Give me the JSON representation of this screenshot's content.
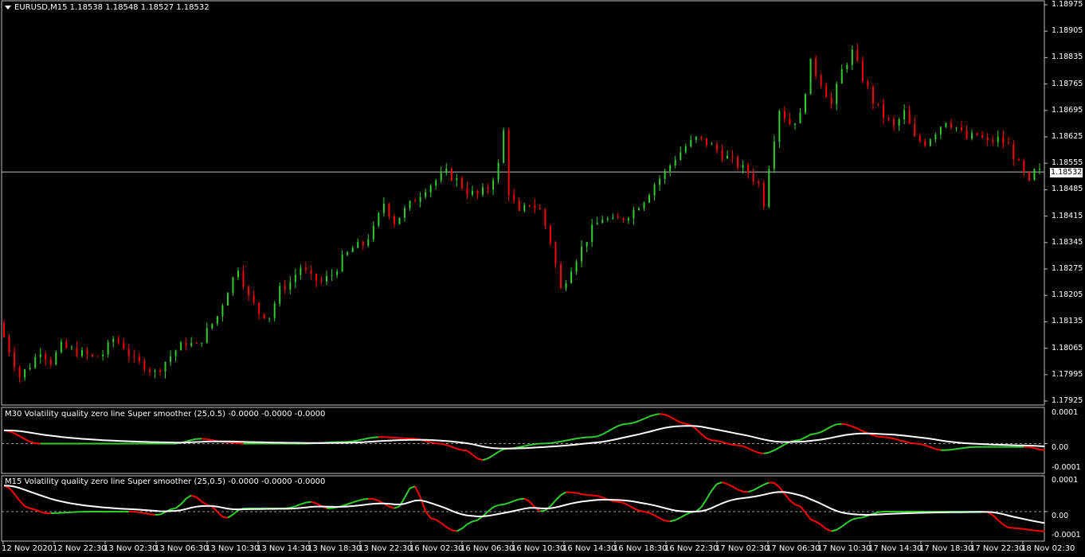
{
  "colors": {
    "background": "#000000",
    "bull": "#32CD32",
    "bear": "#FF0000",
    "signal": "#FFFFFF",
    "grid": "#C0C0C0",
    "price_line": "#C0C0C0"
  },
  "main": {
    "symbol_title": "EURUSD,M15  1.18538 1.18548 1.18527 1.18532",
    "current_price": "1.18532",
    "price_axis": [
      "1.18975",
      "1.18905",
      "1.18835",
      "1.18765",
      "1.18695",
      "1.18625",
      "1.18555",
      "1.18485",
      "1.18415",
      "1.18345",
      "1.18275",
      "1.18205",
      "1.18135",
      "1.18065",
      "1.17995",
      "1.17925"
    ]
  },
  "indicator1": {
    "title": "M30 Volatility quality zero line Super smoother (25,0.5) -0.0000 -0.0000 -0.0000",
    "axis": [
      "0.0001",
      "0.00",
      "-0.0001"
    ]
  },
  "indicator2": {
    "title": "M15 Volatility quality zero line Super smoother (25,0.5) -0.0000 -0.0000 -0.0000",
    "axis": [
      "0.0001",
      "0.00",
      "-0.0001"
    ]
  },
  "time_axis": [
    "12 Nov 2020",
    "12 Nov 22:30",
    "13 Nov 02:30",
    "13 Nov 06:30",
    "13 Nov 10:30",
    "13 Nov 14:30",
    "13 Nov 18:30",
    "13 Nov 22:30",
    "16 Nov 02:30",
    "16 Nov 06:30",
    "16 Nov 10:30",
    "16 Nov 14:30",
    "16 Nov 18:30",
    "16 Nov 22:30",
    "17 Nov 02:30",
    "17 Nov 06:30",
    "17 Nov 10:30",
    "17 Nov 14:30",
    "17 Nov 18:30",
    "17 Nov 22:30",
    "18 Nov 02:30"
  ],
  "chart_data": {
    "type": "candlestick",
    "symbol": "EURUSD",
    "timeframe": "M15",
    "ohlc_last": {
      "open": 1.18538,
      "high": 1.18548,
      "low": 1.18527,
      "close": 1.18532
    },
    "ylim": [
      1.17925,
      1.18975
    ],
    "price_path": [
      [
        0,
        1.1813
      ],
      [
        2,
        1.1806
      ],
      [
        4,
        1.1799
      ],
      [
        6,
        1.1802
      ],
      [
        8,
        1.1806
      ],
      [
        10,
        1.1803
      ],
      [
        12,
        1.1807
      ],
      [
        14,
        1.1806
      ],
      [
        16,
        1.1805
      ],
      [
        18,
        1.1804
      ],
      [
        20,
        1.1805
      ],
      [
        22,
        1.1809
      ],
      [
        24,
        1.1807
      ],
      [
        26,
        1.1803
      ],
      [
        28,
        1.1802
      ],
      [
        30,
        1.18
      ],
      [
        32,
        1.1803
      ],
      [
        34,
        1.1806
      ],
      [
        36,
        1.1808
      ],
      [
        38,
        1.1807
      ],
      [
        40,
        1.1811
      ],
      [
        42,
        1.1815
      ],
      [
        44,
        1.1822
      ],
      [
        46,
        1.1828
      ],
      [
        48,
        1.182
      ],
      [
        50,
        1.1816
      ],
      [
        52,
        1.1815
      ],
      [
        54,
        1.1822
      ],
      [
        56,
        1.1824
      ],
      [
        58,
        1.1828
      ],
      [
        60,
        1.1825
      ],
      [
        62,
        1.1824
      ],
      [
        64,
        1.1826
      ],
      [
        66,
        1.183
      ],
      [
        68,
        1.1833
      ],
      [
        70,
        1.1834
      ],
      [
        72,
        1.1838
      ],
      [
        74,
        1.1845
      ],
      [
        76,
        1.184
      ],
      [
        78,
        1.1843
      ],
      [
        80,
        1.1846
      ],
      [
        82,
        1.1849
      ],
      [
        84,
        1.1851
      ],
      [
        86,
        1.1853
      ],
      [
        88,
        1.1851
      ],
      [
        90,
        1.1848
      ],
      [
        92,
        1.1847
      ],
      [
        94,
        1.1849
      ],
      [
        96,
        1.1855
      ],
      [
        97,
        1.1864
      ],
      [
        98,
        1.1848
      ],
      [
        100,
        1.1842
      ],
      [
        102,
        1.1845
      ],
      [
        104,
        1.1843
      ],
      [
        106,
        1.1835
      ],
      [
        108,
        1.1822
      ],
      [
        110,
        1.1828
      ],
      [
        112,
        1.1833
      ],
      [
        114,
        1.1838
      ],
      [
        116,
        1.1841
      ],
      [
        118,
        1.184
      ],
      [
        120,
        1.1841
      ],
      [
        122,
        1.1843
      ],
      [
        124,
        1.1846
      ],
      [
        126,
        1.185
      ],
      [
        128,
        1.1853
      ],
      [
        130,
        1.1857
      ],
      [
        132,
        1.186
      ],
      [
        134,
        1.1862
      ],
      [
        136,
        1.1861
      ],
      [
        138,
        1.1859
      ],
      [
        140,
        1.1857
      ],
      [
        142,
        1.1855
      ],
      [
        144,
        1.1853
      ],
      [
        146,
        1.185
      ],
      [
        147,
        1.1845
      ],
      [
        148,
        1.1855
      ],
      [
        150,
        1.187
      ],
      [
        152,
        1.1866
      ],
      [
        154,
        1.1868
      ],
      [
        156,
        1.1882
      ],
      [
        158,
        1.1877
      ],
      [
        160,
        1.1871
      ],
      [
        162,
        1.188
      ],
      [
        164,
        1.1885
      ],
      [
        166,
        1.1878
      ],
      [
        168,
        1.1872
      ],
      [
        170,
        1.1868
      ],
      [
        172,
        1.1865
      ],
      [
        174,
        1.1869
      ],
      [
        176,
        1.1862
      ],
      [
        178,
        1.1861
      ],
      [
        180,
        1.1864
      ],
      [
        182,
        1.1867
      ],
      [
        184,
        1.1865
      ],
      [
        186,
        1.1862
      ],
      [
        188,
        1.1863
      ],
      [
        190,
        1.1861
      ],
      [
        192,
        1.1862
      ],
      [
        194,
        1.186
      ],
      [
        196,
        1.1855
      ],
      [
        198,
        1.185
      ],
      [
        199,
        1.18532
      ]
    ]
  }
}
